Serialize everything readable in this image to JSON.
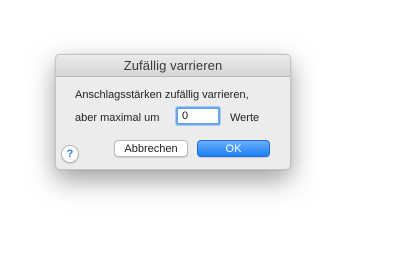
{
  "dialog": {
    "title": "Zufällig varrieren",
    "prompt_line1": "Anschlagsstärken zufällig varrieren,",
    "prompt_line2": "aber maximal um",
    "amount_value": "0",
    "unit_label": "Werte",
    "help_glyph": "?",
    "cancel_label": "Abbrechen",
    "ok_label": "OK"
  },
  "icons": {
    "help": "help-icon"
  },
  "colors": {
    "accent": "#1c7ef6",
    "focus_ring": "#6aa3ee",
    "dialog_bg": "#ececec"
  }
}
